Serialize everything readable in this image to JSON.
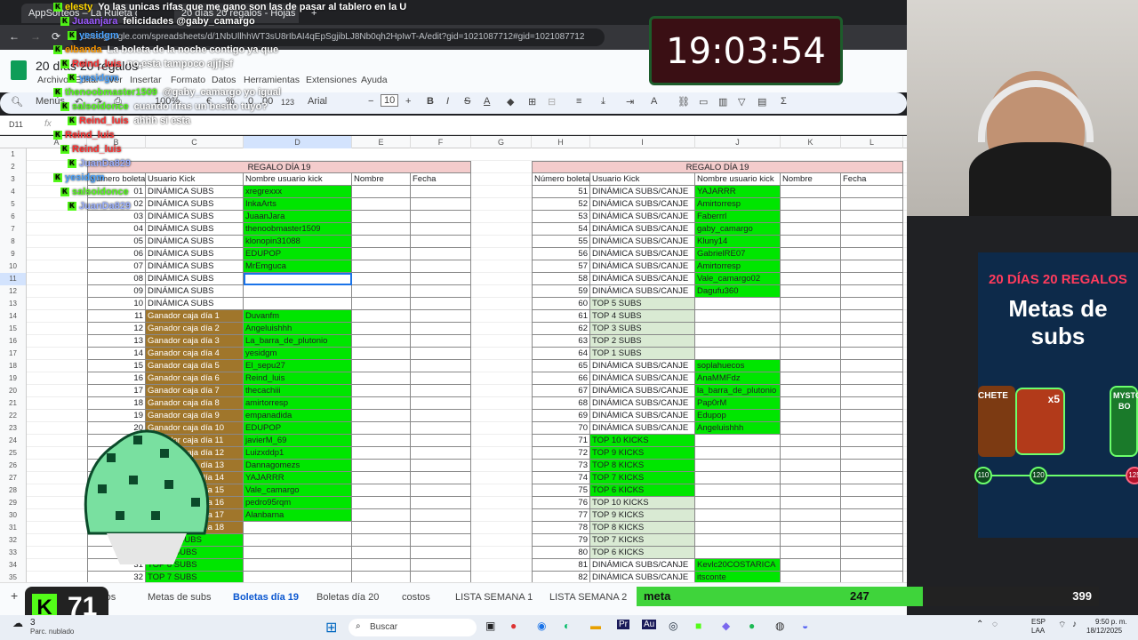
{
  "browser": {
    "tabs": [
      "AppSorteos – La Ruleta de la...",
      "20 días 20 regalos - Hojas de c..."
    ],
    "url": "docs.google.com/spreadsheets/d/1NbUllhhWT3sU8rIbAI4qEpSgjibLJ8Nb0qh2HpIwT-A/edit?gid=1021087712#gid=1021087712"
  },
  "sheets": {
    "doc_title": "20 días 20 regalos",
    "menu": [
      "Archivo",
      "Editar",
      "Ver",
      "Insertar",
      "Formato",
      "Datos",
      "Herramientas",
      "Extensiones",
      "Ayuda"
    ],
    "toolbar": {
      "search": "Menús",
      "zoom": "100%",
      "currency": "€",
      "percent": "%",
      "dec1": ".0",
      "dec2": ".00",
      "fmt": "123",
      "font": "Arial",
      "size": "10"
    },
    "name_box": "D11",
    "fx": "fx",
    "columns": [
      "A",
      "B",
      "C",
      "D",
      "E",
      "F",
      "G",
      "H",
      "I",
      "J",
      "K",
      "L"
    ],
    "rows": [
      "1",
      "2",
      "3",
      "4",
      "5",
      "6",
      "7",
      "8",
      "9",
      "10",
      "11",
      "12",
      "13",
      "14",
      "15",
      "16",
      "17",
      "18",
      "19",
      "20",
      "21",
      "22",
      "23",
      "24",
      "25",
      "26",
      "27",
      "28",
      "29",
      "30",
      "31",
      "32",
      "33",
      "34",
      "35"
    ]
  },
  "left_table": {
    "title": "REGALO DÍA 19",
    "headers": [
      "Número boleta",
      "Usuario Kick",
      "Nombre usuario kick",
      "Nombre",
      "Fecha"
    ],
    "rows": [
      [
        "01",
        "DINÁMICA SUBS",
        "xregrexxx",
        "g"
      ],
      [
        "02",
        "DINÁMICA SUBS",
        "InkaArts",
        "g"
      ],
      [
        "03",
        "DINÁMICA SUBS",
        "JuaanJara",
        "g"
      ],
      [
        "04",
        "DINÁMICA SUBS",
        "thenoobmaster1509",
        "g"
      ],
      [
        "05",
        "DINÁMICA SUBS",
        "klonopin31088",
        "g"
      ],
      [
        "06",
        "DINÁMICA SUBS",
        "EDUPOP",
        "g"
      ],
      [
        "07",
        "DINÁMICA SUBS",
        "MrEmguca",
        "g"
      ],
      [
        "08",
        "DINÁMICA SUBS",
        "",
        "w"
      ],
      [
        "09",
        "DINÁMICA SUBS",
        "",
        "w"
      ],
      [
        "10",
        "DINÁMICA SUBS",
        "",
        "w"
      ],
      [
        "11",
        "Ganador caja día 1",
        "Duvanfm",
        "b"
      ],
      [
        "12",
        "Ganador caja día 2",
        "Angeluishhh",
        "b"
      ],
      [
        "13",
        "Ganador caja día 3",
        "La_barra_de_plutonio",
        "b"
      ],
      [
        "14",
        "Ganador caja día 4",
        "yesidgm",
        "b"
      ],
      [
        "15",
        "Ganador caja día 5",
        "El_sepu27",
        "b"
      ],
      [
        "16",
        "Ganador caja día 6",
        "Reind_luis",
        "b"
      ],
      [
        "17",
        "Ganador caja día 7",
        "thecachiii",
        "b"
      ],
      [
        "18",
        "Ganador caja día 8",
        "amirtorresp",
        "b"
      ],
      [
        "19",
        "Ganador caja día 9",
        "empanadida",
        "b"
      ],
      [
        "20",
        "Ganador caja día 10",
        "EDUPOP",
        "b"
      ],
      [
        "21",
        "Ganador caja día 11",
        "javierM_69",
        "b"
      ],
      [
        "22",
        "Ganador caja día 12",
        "Luizxddp1",
        "b"
      ],
      [
        "23",
        "Ganador caja día 13",
        "Dannagomezs",
        "b"
      ],
      [
        "24",
        "Ganador caja día 14",
        "YAJARRR",
        "b"
      ],
      [
        "25",
        "Ganador caja día 15",
        "Vale_camargo",
        "b"
      ],
      [
        "26",
        "Ganador caja día 16",
        "pedro95rqm",
        "b"
      ],
      [
        "27",
        "Ganador caja día 17",
        "Alanbarna",
        "b"
      ],
      [
        "28",
        "Ganador caja día 18",
        "",
        "bw"
      ],
      [
        "29",
        "TOP 10 SUBS",
        "",
        "t"
      ],
      [
        "30",
        "TOP 9 SUBS",
        "",
        "t"
      ],
      [
        "31",
        "TOP 8 SUBS",
        "",
        "t"
      ],
      [
        "32",
        "TOP 7 SUBS",
        "",
        "t"
      ]
    ]
  },
  "right_table": {
    "title": "REGALO DÍA 19",
    "headers": [
      "Número boleta",
      "Usuario Kick",
      "Nombre usuario kick",
      "Nombre",
      "Fecha"
    ],
    "rows": [
      [
        "51",
        "DINÁMICA SUBS/CANJE",
        "YAJARRR",
        "g"
      ],
      [
        "52",
        "DINÁMICA SUBS/CANJE",
        "Amirtorresp",
        "g"
      ],
      [
        "53",
        "DINÁMICA SUBS/CANJE",
        "Faberrrl",
        "g"
      ],
      [
        "54",
        "DINÁMICA SUBS/CANJE",
        "gaby_camargo",
        "g"
      ],
      [
        "55",
        "DINÁMICA SUBS/CANJE",
        "Kluny14",
        "g"
      ],
      [
        "56",
        "DINÁMICA SUBS/CANJE",
        "GabrielRE07",
        "g"
      ],
      [
        "57",
        "DINÁMICA SUBS/CANJE",
        "Amirtorresp",
        "g"
      ],
      [
        "58",
        "DINÁMICA SUBS/CANJE",
        "Vale_camargo02",
        "g"
      ],
      [
        "59",
        "DINÁMICA SUBS/CANJE",
        "Dagufu360",
        "g"
      ],
      [
        "60",
        "TOP 5 SUBS",
        "",
        "lg"
      ],
      [
        "61",
        "TOP 4 SUBS",
        "",
        "lg"
      ],
      [
        "62",
        "TOP 3 SUBS",
        "",
        "lg"
      ],
      [
        "63",
        "TOP 2 SUBS",
        "",
        "lg"
      ],
      [
        "64",
        "TOP 1 SUBS",
        "",
        "lg"
      ],
      [
        "65",
        "DINÁMICA SUBS/CANJE",
        "soplahuecos",
        "g"
      ],
      [
        "66",
        "DINÁMICA SUBS/CANJE",
        "AnaMMFdz",
        "g"
      ],
      [
        "67",
        "DINÁMICA SUBS/CANJE",
        "la_barra_de_plutonio",
        "g"
      ],
      [
        "68",
        "DINÁMICA SUBS/CANJE",
        "Pap0rM",
        "g"
      ],
      [
        "69",
        "DINÁMICA SUBS/CANJE",
        "Edupop",
        "g"
      ],
      [
        "70",
        "DINÁMICA SUBS/CANJE",
        "Angeluishhh",
        "g"
      ],
      [
        "71",
        "TOP 10 KICKS",
        "",
        "gi"
      ],
      [
        "72",
        "TOP 9 KICKS",
        "",
        "gi"
      ],
      [
        "73",
        "TOP 8 KICKS",
        "",
        "gi"
      ],
      [
        "74",
        "TOP 7 KICKS",
        "",
        "gi"
      ],
      [
        "75",
        "TOP 6 KICKS",
        "",
        "gi"
      ],
      [
        "76",
        "TOP 10 KICKS",
        "",
        "lg"
      ],
      [
        "77",
        "TOP 9 KICKS",
        "",
        "lg"
      ],
      [
        "78",
        "TOP 8 KICKS",
        "",
        "lg"
      ],
      [
        "79",
        "TOP 7 KICKS",
        "",
        "lg"
      ],
      [
        "80",
        "TOP 6 KICKS",
        "",
        "lg"
      ],
      [
        "81",
        "DINÁMICA SUBS/CANJE",
        "Kevlc20COSTARICA",
        "g"
      ],
      [
        "82",
        "DINÁMICA SUBS/CANJE",
        "itsconte",
        "g"
      ]
    ]
  },
  "sheet_tabs": [
    "galos",
    "Metas de subs",
    "Boletas día 19",
    "Boletas día 20",
    "costos",
    "LISTA SEMANA 1",
    "LISTA SEMANA 2"
  ],
  "overlay": {
    "clock": "19:03:54",
    "promo_line1": "20 DÍAS 20 REGALOS",
    "promo_title": "Metas de subs",
    "promo_labels": [
      "CHETE",
      "x5",
      "MYSTO",
      "BO",
      "110",
      "120",
      "125"
    ],
    "meta_label": "meta",
    "meta_current": "247",
    "meta_goal": "399",
    "meta_progress": 0.619,
    "kick_count": "71",
    "kick_logo": "K",
    "chat": [
      {
        "user": "elesty",
        "msg": "Yo las unicas rifas que me gano son las de pasar al tablero en la U",
        "color": "#ffd700"
      },
      {
        "user": "Juaanjara",
        "msg": "felicidades @gaby_camargo",
        "color": "#9b59ff"
      },
      {
        "user": "yesidgm",
        "msg": "",
        "color": "#4aa3ff"
      },
      {
        "user": "elbanda",
        "msg": "La boleta de la noche contigo ya que",
        "color": "#ff9900"
      },
      {
        "user": "Reind_luis",
        "msg": "no esta tampoco ajjfjsf",
        "color": "#ff3030"
      },
      {
        "user": "yesidgm",
        "msg": "",
        "color": "#4aa3ff"
      },
      {
        "user": "thenoobmaster1509",
        "msg": "@gaby_camargo yo igual",
        "color": "#53fc18"
      },
      {
        "user": "salsoidonce",
        "msg": "cuando rifas un besito tuyo?",
        "color": "#53fc18"
      },
      {
        "user": "Reind_luis",
        "msg": "ahhh si esta",
        "color": "#ff3030"
      },
      {
        "user": "Reind_luis",
        "msg": "",
        "color": "#ff3030"
      },
      {
        "user": "Reind_luis",
        "msg": "",
        "color": "#ff3030"
      },
      {
        "user": "JuanDa829",
        "msg": "",
        "color": "#9bb0ff"
      },
      {
        "user": "yesidgm",
        "msg": "",
        "color": "#4aa3ff"
      },
      {
        "user": "salsoidonce",
        "msg": "",
        "color": "#53fc18"
      },
      {
        "user": "JuanDa829",
        "msg": "",
        "color": "#9bb0ff"
      }
    ]
  },
  "taskbar": {
    "search": "Buscar",
    "weather_temp": "3",
    "weather": "Parc. nublado",
    "lang1": "ESP",
    "lang2": "LAA",
    "time": "9:50 p. m.",
    "date": "18/12/2025"
  }
}
